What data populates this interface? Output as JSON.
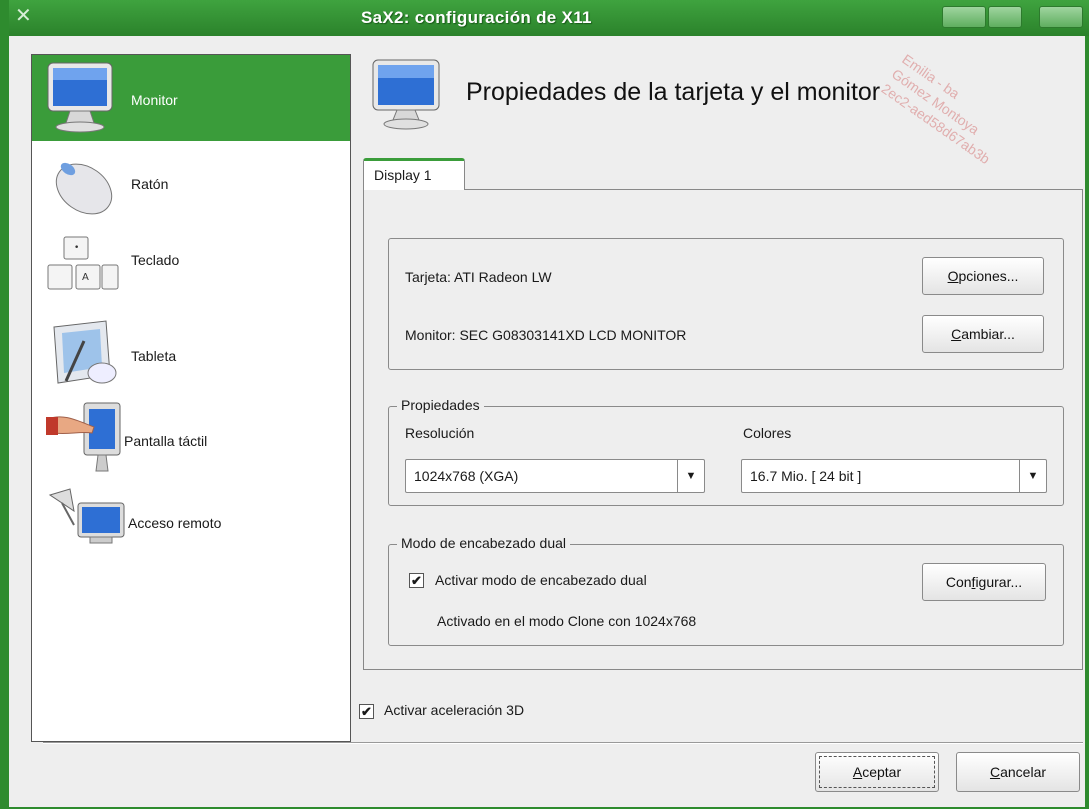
{
  "window": {
    "title": "SaX2: configuración de X11"
  },
  "sidebar": {
    "items": [
      {
        "label": "Monitor",
        "icon": "monitor-icon",
        "selected": true
      },
      {
        "label": "Ratón",
        "icon": "mouse-icon"
      },
      {
        "label": "Teclado",
        "icon": "keyboard-icon"
      },
      {
        "label": "Tableta",
        "icon": "tablet-icon"
      },
      {
        "label": "Pantalla táctil",
        "icon": "touchscreen-icon"
      },
      {
        "label": "Acceso remoto",
        "icon": "remote-access-icon"
      }
    ]
  },
  "header": {
    "title": "Propiedades de la tarjeta y el monitor",
    "icon": "monitor-icon"
  },
  "tabs": [
    {
      "label": "Display 1",
      "active": true
    }
  ],
  "card": {
    "tarjeta": "Tarjeta:  ATI Radeon LW",
    "monitor": "Monitor:  SEC G08303141XD LCD MONITOR",
    "opciones_button": {
      "mnemonic": "O",
      "rest": "pciones..."
    },
    "cambiar_button": {
      "mnemonic": "C",
      "rest": "ambiar..."
    }
  },
  "propiedades": {
    "legend": "Propiedades",
    "resolucion_label": "Resolución",
    "resolucion_value": "1024x768 (XGA)",
    "colores_label": "Colores",
    "colores_value": "16.7 Mio. [ 24 bit ]"
  },
  "dual": {
    "legend": "Modo de encabezado dual",
    "checkbox_label": "Activar modo de encabezado dual",
    "checked": true,
    "status": "Activado en el modo Clone con 1024x768",
    "configurar_button": {
      "before": "Con",
      "mnemonic": "f",
      "after": "igurar..."
    }
  },
  "accel": {
    "label": "Activar aceleración 3D",
    "checked": true
  },
  "footer": {
    "aceptar_button": {
      "mnemonic": "A",
      "rest": "ceptar"
    },
    "cancelar_button": {
      "mnemonic": "C",
      "rest": "ancelar"
    }
  },
  "watermark": [
    "Emilia - ba",
    "Gómez Montoya",
    "2ec2-aed58d67ab3b"
  ],
  "colors": {
    "accent": "#3a9c3a",
    "titlebar": "#2e8b2e"
  },
  "check_glyph": "✔",
  "arrow_glyph": "▼"
}
